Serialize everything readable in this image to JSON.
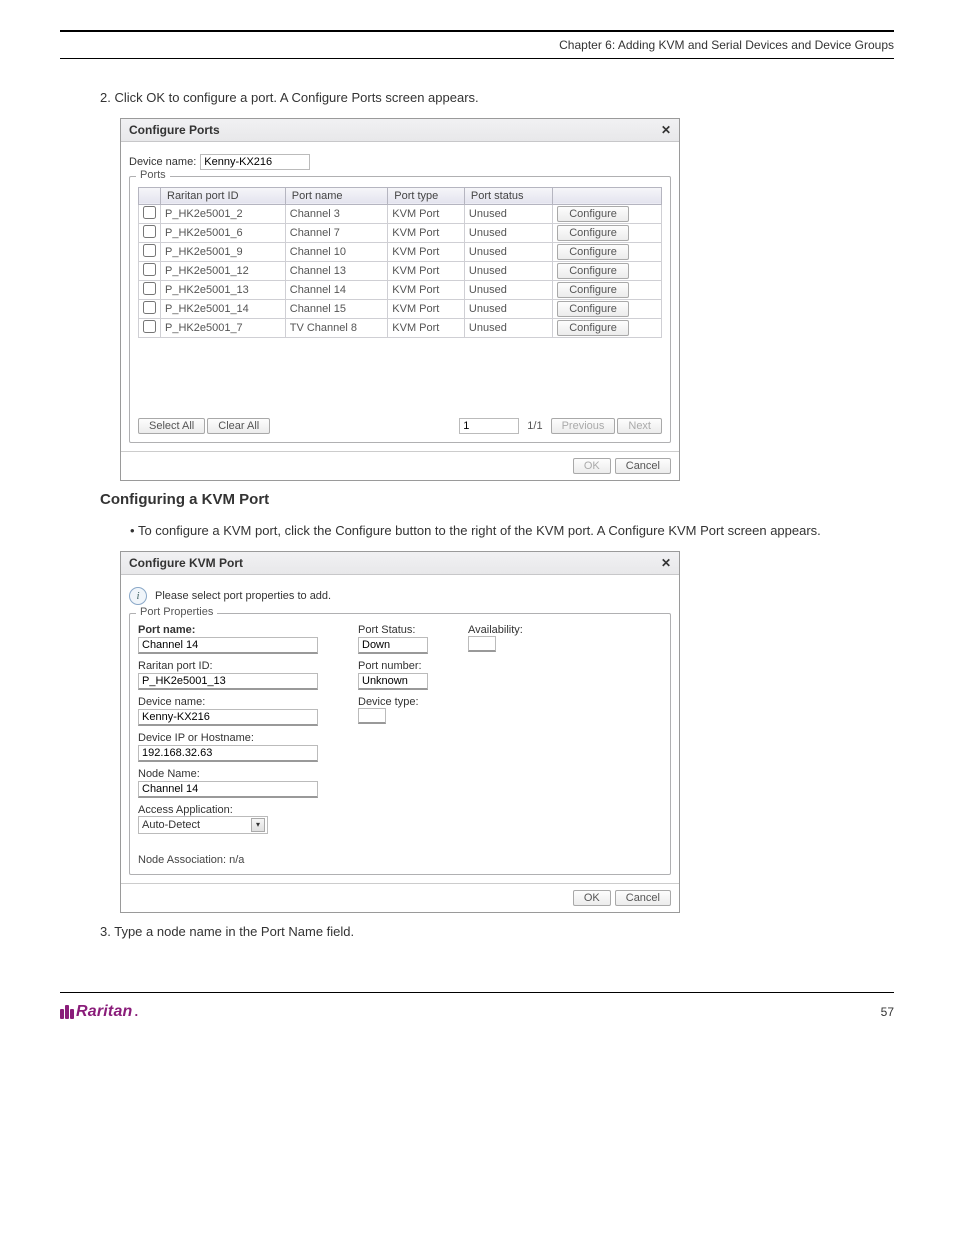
{
  "doc": {
    "chapter": "Chapter 6: Adding KVM and Serial Devices and Device Groups",
    "step2": "2.  Click OK to configure a port. A Configure Ports screen appears.",
    "section_title": "Configuring a KVM Port",
    "bullet_text": "To configure a KVM port, click the Configure button to the right of the KVM port. A Configure KVM Port screen appears.",
    "step3": "3.  Type a node name in the Port Name field."
  },
  "dialog1": {
    "title": "Configure Ports",
    "close": "✕",
    "device_name_label": "Device name:",
    "device_name_value": "Kenny-KX216",
    "ports_legend": "Ports",
    "columns": {
      "id": "Raritan port ID",
      "name": "Port name",
      "type": "Port type",
      "status": "Port status"
    },
    "rows": [
      {
        "id": "P_HK2e5001_2",
        "name": "Channel 3",
        "type": "KVM Port",
        "status": "Unused",
        "btn": "Configure"
      },
      {
        "id": "P_HK2e5001_6",
        "name": "Channel 7",
        "type": "KVM Port",
        "status": "Unused",
        "btn": "Configure"
      },
      {
        "id": "P_HK2e5001_9",
        "name": "Channel 10",
        "type": "KVM Port",
        "status": "Unused",
        "btn": "Configure"
      },
      {
        "id": "P_HK2e5001_12",
        "name": "Channel 13",
        "type": "KVM Port",
        "status": "Unused",
        "btn": "Configure"
      },
      {
        "id": "P_HK2e5001_13",
        "name": "Channel 14",
        "type": "KVM Port",
        "status": "Unused",
        "btn": "Configure"
      },
      {
        "id": "P_HK2e5001_14",
        "name": "Channel 15",
        "type": "KVM Port",
        "status": "Unused",
        "btn": "Configure"
      },
      {
        "id": "P_HK2e5001_7",
        "name": "TV Channel 8",
        "type": "KVM Port",
        "status": "Unused",
        "btn": "Configure"
      }
    ],
    "select_all": "Select All",
    "clear_all": "Clear All",
    "page_value": "1",
    "page_total": "1/1",
    "prev": "Previous",
    "next": "Next",
    "ok": "OK",
    "cancel": "Cancel"
  },
  "dialog2": {
    "title": "Configure KVM Port",
    "close": "✕",
    "info_text": "Please select port properties to add.",
    "legend": "Port Properties",
    "port_name_label": "Port name:",
    "port_name_value": "Channel 14",
    "raritan_id_label": "Raritan port ID:",
    "raritan_id_value": "P_HK2e5001_13",
    "device_name_label": "Device name:",
    "device_name_value": "Kenny-KX216",
    "device_ip_label": "Device IP or Hostname:",
    "device_ip_value": "192.168.32.63",
    "node_name_label": "Node Name:",
    "node_name_value": "Channel 14",
    "access_app_label": "Access Application:",
    "access_app_value": "Auto-Detect",
    "port_status_label": "Port Status:",
    "port_status_value": "Down",
    "port_number_label": "Port number:",
    "port_number_value": "Unknown",
    "device_type_label": "Device type:",
    "availability_label": "Availability:",
    "node_assoc": "Node Association: n/a",
    "ok": "OK",
    "cancel": "Cancel"
  },
  "footer": {
    "brand": "Raritan",
    "page": "57"
  }
}
